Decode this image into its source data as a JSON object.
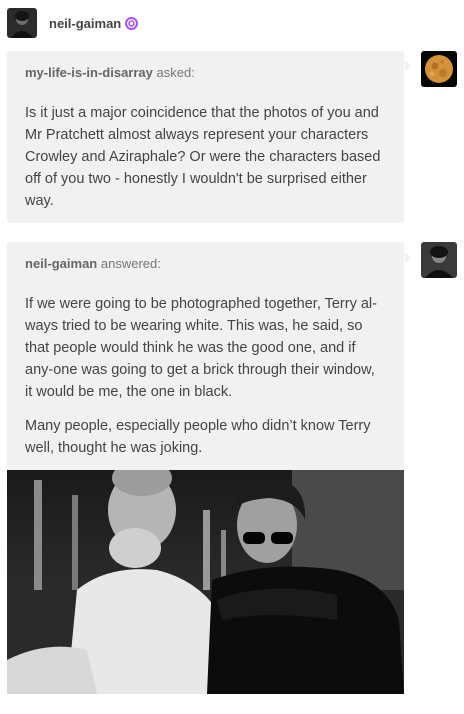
{
  "header": {
    "author": "neil-gaiman",
    "badge_icon": "lollipop-icon",
    "badge_color": "#a855f7"
  },
  "question": {
    "asker": "my-life-is-in-disarray",
    "verb": "asked:",
    "text": "Is it just a major coincidence that the photos of you and Mr Pratchett almost always represent your characters Crowley and Aziraphale? Or were the characters based off of you two - honestly I wouldn't be surprised either way."
  },
  "answer": {
    "answerer": "neil-gaiman",
    "verb": "answered:",
    "paragraphs": [
      "If we were going to be photographed together, Terry al-ways tried to be wearing white. This was, he said, so that people would think he was the good one, and if any-one was going to get a brick through their window, it would be me, the one in black.",
      "Many people, especially people who didn’t know Terry well, thought he was joking."
    ]
  },
  "colors": {
    "card_bg": "#f1f1f1",
    "text": "#444444",
    "meta": "#777777"
  }
}
